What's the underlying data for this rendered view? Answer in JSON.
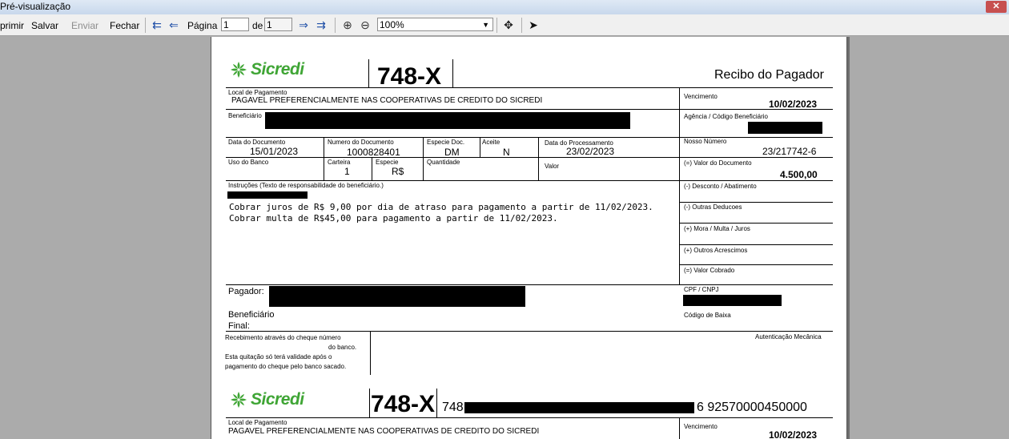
{
  "window": {
    "title": "Pré-visualização"
  },
  "toolbar": {
    "print_label": "primir",
    "save_label": "Salvar",
    "send_label": "Enviar",
    "close_label": "Fechar",
    "page_label": "Página",
    "page_value": "1",
    "of_label": "de",
    "page_total": "1",
    "zoom_value": "100%",
    "icons": [
      "first-page-icon",
      "prev-page-icon",
      "next-page-icon",
      "last-page-icon",
      "zoom-in-icon",
      "zoom-out-icon",
      "move-icon",
      "pointer-icon"
    ]
  },
  "receipt": {
    "brand": "Sicredi",
    "bank_code": "748-X",
    "title": "Recibo do Pagador",
    "local_pagamento_label": "Local de Pagamento",
    "local_pagamento_value": "PAGAVEL PREFERENCIALMENTE NAS COOPERATIVAS DE CREDITO DO SICREDI",
    "vencimento_label": "Vencimento",
    "vencimento_value": "10/02/2023",
    "beneficiario_label": "Beneficiário",
    "agencia_label": "Agência / Código Beneficiário",
    "data_documento_label": "Data do Documento",
    "data_documento_value": "15/01/2023",
    "numero_documento_label": "Numero do Documento",
    "numero_documento_value": "1000828401",
    "especie_doc_label": "Especie Doc.",
    "especie_doc_value": "DM",
    "aceite_label": "Aceite",
    "aceite_value": "N",
    "data_processamento_label": "Data do Processamento",
    "data_processamento_value": "23/02/2023",
    "nosso_numero_label": "Nosso Número",
    "nosso_numero_value": "23/217742-6",
    "uso_banco_label": "Uso do Banco",
    "carteira_label": "Carteira",
    "carteira_value": "1",
    "especie_label": "Especie",
    "especie_value": "R$",
    "quantidade_label": "Quantidade",
    "valor_label": "Valor",
    "valor_documento_label": "(=) Valor do Documento",
    "valor_documento_value": "4.500,00",
    "instrucoes_label": "Instruções (Texto de responsabilidade do beneficiário.)",
    "instrucao_1": "Cobrar juros de R$ 9,00 por dia de atraso para pagamento a partir de 11/02/2023.",
    "instrucao_2": "Cobrar multa de R$45,00 para pagamento a partir de 11/02/2023.",
    "desconto_label": "(-) Desconto / Abatimento",
    "outras_deducoes_label": "(-) Outras Deducoes",
    "mora_label": "(+) Mora / Multa / Juros",
    "outros_acrescimos_label": "(+) Outros Acrescimos",
    "valor_cobrado_label": "(=) Valor Cobrado",
    "pagador_label": "Pagador:",
    "cpf_cnpj_label": "CPF / CNPJ",
    "beneficiario_final_label": "Beneficiário",
    "final_label": "Final:",
    "codigo_baixa_label": "Código de Baixa",
    "cheque_line_1": "Recebimento através do cheque número",
    "cheque_line_2": "do banco.",
    "cheque_line_3": "Esta quitação só terá validade após o",
    "cheque_line_4": "pagamento do cheque pelo banco sacado.",
    "autenticacao_label": "Autenticação Mecânica"
  },
  "slip": {
    "brand": "Sicredi",
    "bank_code": "748-X",
    "linha_digitavel_prefix": "748",
    "linha_digitavel_suffix": "6 92570000450000",
    "local_pagamento_label": "Local de Pagamento",
    "local_pagamento_value": "PAGAVEL PREFERENCIALMENTE NAS COOPERATIVAS DE CREDITO DO SICREDI",
    "vencimento_label": "Vencimento",
    "vencimento_value": "10/02/2023"
  }
}
